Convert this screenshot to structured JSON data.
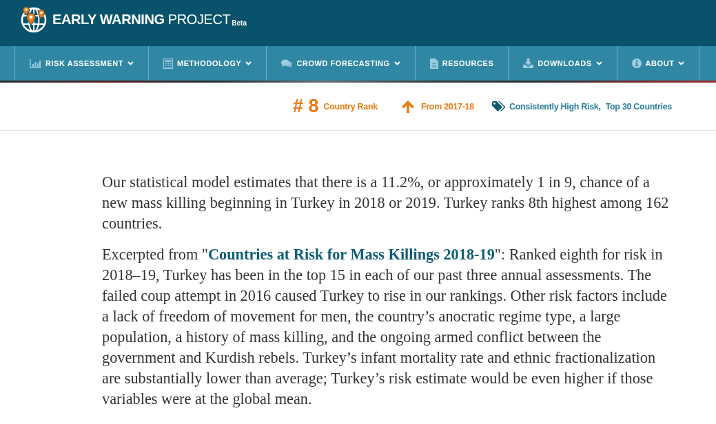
{
  "header": {
    "brand": "**EARLY WARNING** PROJECT",
    "badge": "Beta"
  },
  "nav": {
    "items": [
      {
        "label": "RISK ASSESSMENT",
        "dropdown": true
      },
      {
        "label": "METHODOLOGY",
        "dropdown": true
      },
      {
        "label": "CROWD FORECASTING",
        "dropdown": true
      },
      {
        "label": "RESOURCES",
        "dropdown": false
      },
      {
        "label": "DOWNLOADS",
        "dropdown": true
      },
      {
        "label": "ABOUT",
        "dropdown": true
      }
    ]
  },
  "country_summary": {
    "rank": "# 8",
    "rank_label": "Country Rank",
    "trend": {
      "rising": true,
      "label": "From 2017-18"
    },
    "tags": [
      "Consistently High Risk,",
      "Top 30 Countries"
    ]
  },
  "article": {
    "paragraphs": [
      {
        "text": "Our statistical model estimates that there is a 11.2%, or approximately 1 in 9, chance of a new mass killing beginning in Turkey in 2018 or 2019. Turkey ranks 8th highest among 162 countries."
      },
      {
        "text_before": "Excerpted from \"",
        "link": "Countries at Risk for Mass Killings 2018-19",
        "text_after": "\": Ranked eighth for risk in 2018–19, Turkey has been in the top 15 in each of our past three annual assessments. The failed coup attempt in 2016 caused Turkey to rise in our rankings. Other risk factors include a lack of freedom of movement for men, the country’s anocratic regime type, a large population, a history of mass killing, and the ongoing armed conflict between the government and Kurdish rebels. Turkey’s infant mortality rate and ethnic fractionalization are substantially lower than average; Turkey’s risk estimate would be even higher if those variables were at the global mean."
      }
    ]
  }
}
